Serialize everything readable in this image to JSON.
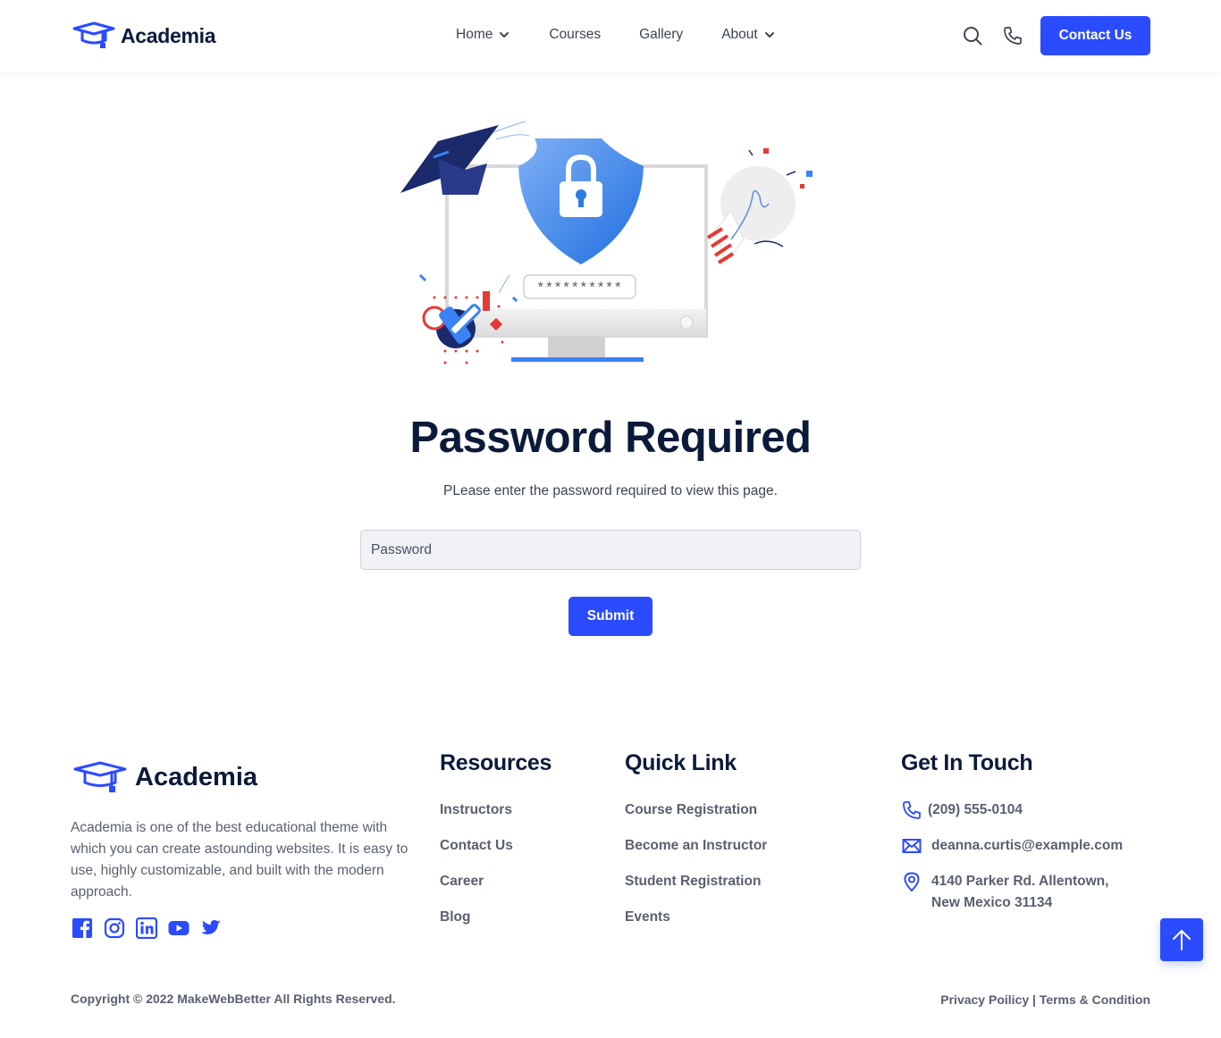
{
  "brand": {
    "name": "Academia",
    "accent": "#2b4bff",
    "dark": "#0c1a3a"
  },
  "nav": {
    "items": [
      {
        "label": "Home",
        "has_dropdown": true
      },
      {
        "label": "Courses",
        "has_dropdown": false
      },
      {
        "label": "Gallery",
        "has_dropdown": false
      },
      {
        "label": "About",
        "has_dropdown": true
      }
    ],
    "search_icon": "search-icon",
    "phone_icon": "phone-icon",
    "contact_label": "Contact Us"
  },
  "illustration": {
    "masked_password": "**********"
  },
  "main": {
    "title": "Password Required",
    "subtitle": "PLease enter the password required to view this page.",
    "password_placeholder": "Password",
    "submit_label": "Submit"
  },
  "footer": {
    "brand": "Academia",
    "about": "Academia is one of the best educational theme with which you can create astounding websites. It is easy to use, highly customizable, and built with the modern approach.",
    "socials": [
      "facebook-icon",
      "instagram-icon",
      "linkedin-icon",
      "youtube-icon",
      "twitter-icon"
    ],
    "resources": {
      "title": "Resources",
      "links": [
        "Instructors",
        "Contact Us",
        "Career",
        "Blog"
      ]
    },
    "quick_link": {
      "title": "Quick Link",
      "links": [
        "Course Registration",
        "Become an Instructor",
        "Student Registration",
        "Events"
      ]
    },
    "touch": {
      "title": "Get In Touch",
      "phone": "(209) 555-0104",
      "email": "deanna.curtis@example.com",
      "address_line1": "4140 Parker Rd. Allentown,",
      "address_line2": "New Mexico 31134"
    },
    "copyright": "Copyright © 2022 MakeWebBetter All Rights Reserved.",
    "privacy": "Privacy Poilicy",
    "separator": "|",
    "terms": "Terms & Condition"
  }
}
